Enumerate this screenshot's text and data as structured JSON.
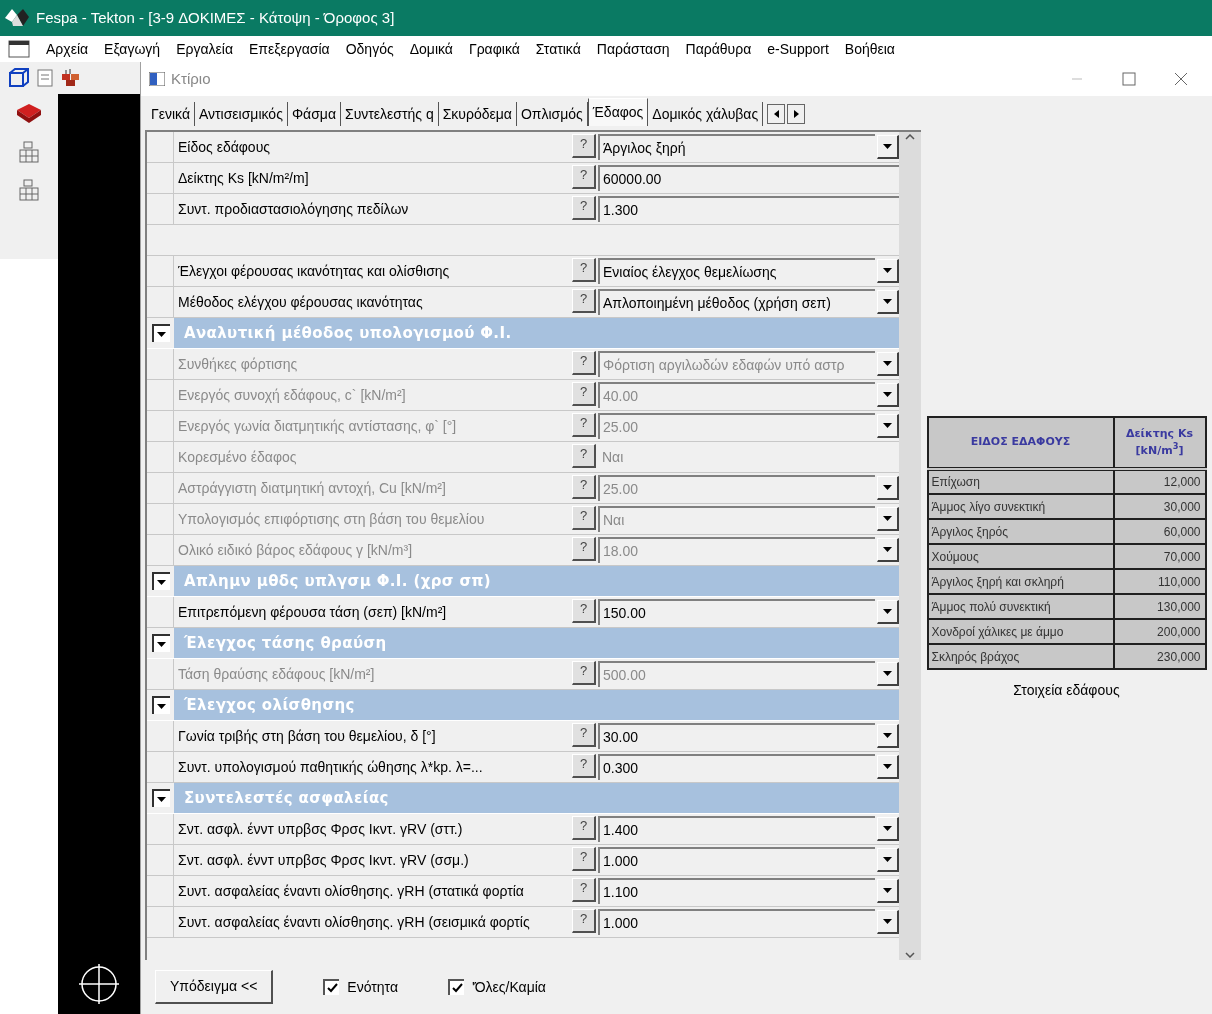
{
  "app": {
    "title": "Fespa - Tekton - [3-9 ΔΟΚΙΜΕΣ - Κάτοψη - Όροφος 3]",
    "menu": [
      "Αρχεία",
      "Εξαγωγή",
      "Εργαλεία",
      "Επεξεργασία",
      "Οδηγός",
      "Δομικά",
      "Γραφικά",
      "Στατικά",
      "Παράσταση",
      "Παράθυρα",
      "e-Support",
      "Βοήθεια"
    ]
  },
  "dialog": {
    "title": "Κτίριο",
    "tabs": [
      {
        "label": "Γενικά",
        "selected": false
      },
      {
        "label": "Αντισεισμικός",
        "selected": false
      },
      {
        "label": "Φάσμα",
        "selected": false
      },
      {
        "label": "Συντελεστής q",
        "selected": false
      },
      {
        "label": "Σκυρόδεμα",
        "selected": false
      },
      {
        "label": "Οπλισμός",
        "selected": false
      },
      {
        "label": "Έδαφος",
        "selected": true
      },
      {
        "label": "Δομικός χάλυβας",
        "selected": false
      }
    ],
    "rows": [
      {
        "kind": "property",
        "label": "Είδος εδάφους",
        "help": "?",
        "value": {
          "kind": "dropdown",
          "text": "Άργιλος ξηρή"
        },
        "disabled": false
      },
      {
        "kind": "property",
        "label": "Δείκτης Ks [kN/m²/m]",
        "help": "?",
        "value": {
          "kind": "field",
          "text": "60000.00"
        },
        "disabled": false
      },
      {
        "kind": "property",
        "label": "Συντ. προδιαστασιολόγησης πεδίλων",
        "help": "?",
        "value": {
          "kind": "field",
          "text": "1.300"
        },
        "disabled": false
      },
      {
        "kind": "blank"
      },
      {
        "kind": "property",
        "label": "Έλεγχοι φέρουσας ικανότητας και ολίσθισης",
        "help": "?",
        "value": {
          "kind": "dropdown",
          "text": "Ενιαίος έλεγχος θεμελίωσης"
        },
        "disabled": false
      },
      {
        "kind": "property",
        "label": "Μέθοδος ελέγχου φέρουσας ικανότητας",
        "help": "?",
        "value": {
          "kind": "dropdown",
          "text": "Απλοποιημένη μέθοδος (χρήση σεπ)"
        },
        "disabled": false
      },
      {
        "kind": "section",
        "label": "Αναλυτική μέθοδος υπολογισμού Φ.Ι.",
        "expanded": true
      },
      {
        "kind": "property",
        "label": "Συνθήκες φόρτισης",
        "help": "?",
        "value": {
          "kind": "dropdown",
          "text": "Φόρτιση αργιλωδών εδαφών υπό αστρ"
        },
        "disabled": true
      },
      {
        "kind": "property",
        "label": "Ενεργός συνοχή εδάφους, c` [kN/m²]",
        "help": "?",
        "value": {
          "kind": "dropdown",
          "text": "40.00"
        },
        "disabled": true
      },
      {
        "kind": "property",
        "label": "Ενεργός γωνία διατμητικής αντίστασης, φ` [°]",
        "help": "?",
        "value": {
          "kind": "dropdown",
          "text": "25.00"
        },
        "disabled": true
      },
      {
        "kind": "property",
        "label": "Κορεσμένο έδαφος",
        "help": "?",
        "value": {
          "kind": "static",
          "text": "Ναι"
        },
        "disabled": true
      },
      {
        "kind": "property",
        "label": "Αστράγγιστη διατμητική αντοχή, Cu [kN/m²]",
        "help": "?",
        "value": {
          "kind": "dropdown",
          "text": "25.00"
        },
        "disabled": true
      },
      {
        "kind": "property",
        "label": "Υπολογισμός επιφόρτισης στη βάση του θεμελίου",
        "help": "?",
        "value": {
          "kind": "dropdown",
          "text": "Ναι"
        },
        "disabled": true
      },
      {
        "kind": "property",
        "label": "Ολικό ειδικό βάρος εδάφους γ [kN/m³]",
        "help": "?",
        "value": {
          "kind": "dropdown",
          "text": "18.00"
        },
        "disabled": true
      },
      {
        "kind": "section",
        "label": "Απλημν μθδς υπλγσμ Φ.Ι. (χρσ σπ)",
        "expanded": true
      },
      {
        "kind": "property",
        "label": "Επιτρεπόμενη φέρουσα τάση (σεπ) [kN/m²]",
        "help": "?",
        "value": {
          "kind": "dropdown",
          "text": "150.00"
        },
        "disabled": false
      },
      {
        "kind": "section",
        "label": "Έλεγχος τάσης θραύση",
        "expanded": true
      },
      {
        "kind": "property",
        "label": "Τάση θραύσης εδάφους [kN/m²]",
        "help": "?",
        "value": {
          "kind": "dropdown",
          "text": "500.00"
        },
        "disabled": true
      },
      {
        "kind": "section",
        "label": "Έλεγχος ολίσθησης",
        "expanded": true
      },
      {
        "kind": "property",
        "label": "Γωνία τριβής στη βάση του θεμελίου, δ [°]",
        "help": "?",
        "value": {
          "kind": "dropdown",
          "text": "30.00"
        },
        "disabled": false
      },
      {
        "kind": "property",
        "label": "Συντ. υπολογισμού παθητικής ώθησης λ*kp. λ=...",
        "help": "?",
        "value": {
          "kind": "dropdown",
          "text": "0.300"
        },
        "disabled": false
      },
      {
        "kind": "section",
        "label": "Συντελεστές ασφαλείας",
        "expanded": true
      },
      {
        "kind": "property",
        "label": "Σντ. ασφλ. έννт υπρβσς Φρσς Ικντ. γRV (στт.)",
        "help": "?",
        "value": {
          "kind": "dropdown",
          "text": "1.400"
        },
        "disabled": false
      },
      {
        "kind": "property",
        "label": "Σντ. ασφλ. έννт υπρβσς Φρσς Ικντ. γRV (σσμ.)",
        "help": "?",
        "value": {
          "kind": "dropdown",
          "text": "1.000"
        },
        "disabled": false
      },
      {
        "kind": "property",
        "label": "Συντ. ασφαλείας έναντι ολίσθησης. γRH (στατικά φορτία",
        "help": "?",
        "value": {
          "kind": "dropdown",
          "text": "1.100"
        },
        "disabled": false
      },
      {
        "kind": "property",
        "label": "Συντ. ασφαλείας έναντι ολίσθησης. γRH (σεισμικά φορτίς",
        "help": "?",
        "value": {
          "kind": "dropdown",
          "text": "1.000"
        },
        "disabled": false
      }
    ],
    "reference": {
      "columns": [
        "ΕΙΔΟΣ ΕΔΑΦΟΥΣ",
        "Δείκτης Ks [kN/m$^{3}$]"
      ],
      "rows": [
        [
          "Επίχωση",
          "12,000"
        ],
        [
          "Άμμος λίγο συνεκτική",
          "30,000"
        ],
        [
          "Άργιλος ξηρός",
          "60,000"
        ],
        [
          "Χούμους",
          "70,000"
        ],
        [
          "Άργιλος ξηρή και σκληρή",
          "110,000"
        ],
        [
          "Άμμος πολύ συνεκτική",
          "130,000"
        ],
        [
          "Χονδροί χάλικες με άμμο",
          "200,000"
        ],
        [
          "Σκληρός βράχος",
          "230,000"
        ]
      ],
      "caption": "Στοιχεία εδάφους"
    },
    "footer": {
      "button": "Υπόδειγμα <<",
      "checkboxes": [
        {
          "label": "Ενότητα",
          "checked": true
        },
        {
          "label": "'Όλες/Καμία",
          "checked": true
        }
      ]
    }
  }
}
